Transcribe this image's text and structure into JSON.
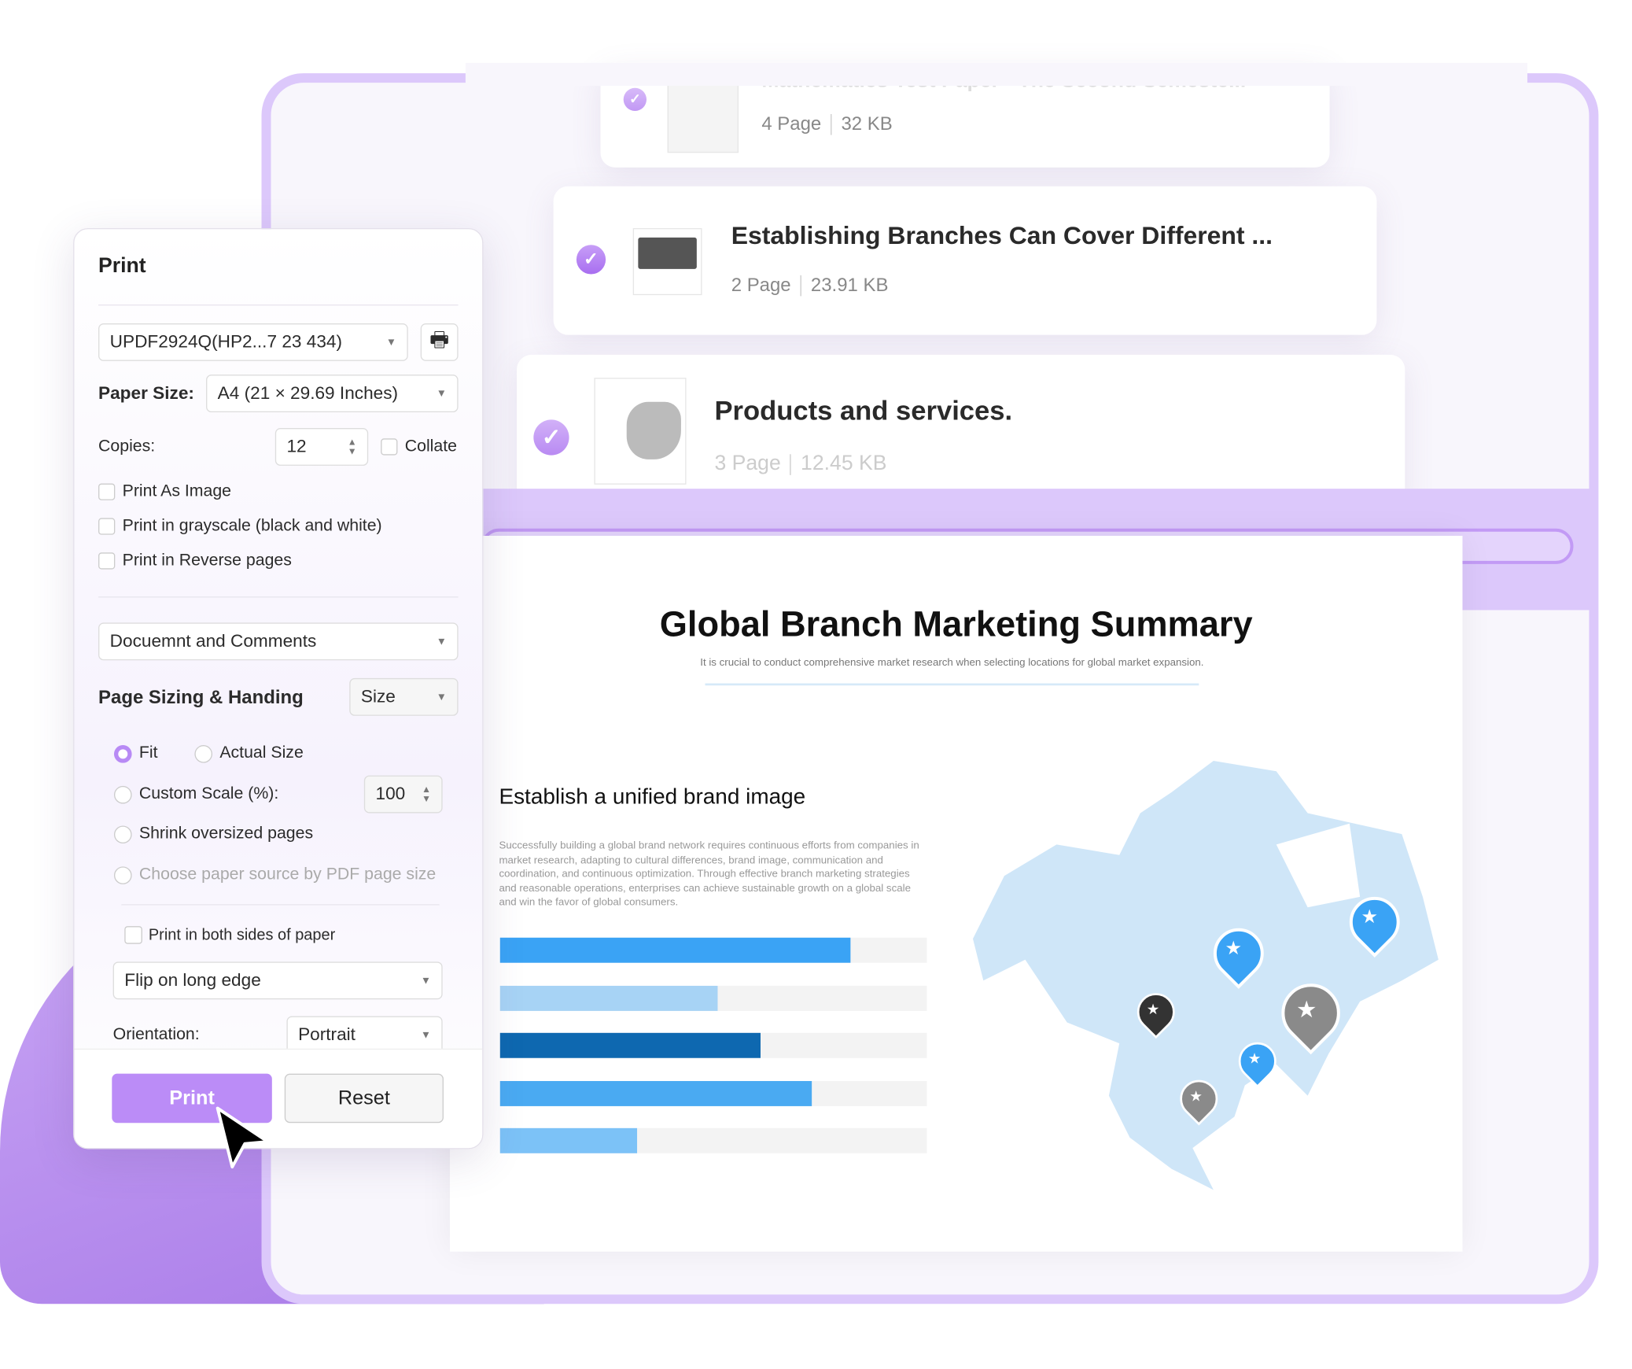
{
  "files": [
    {
      "title": "Mathematics Test Paper - The Second Semeste...",
      "pages": "4 Page",
      "size": "32 KB",
      "checked": true
    },
    {
      "title": "Establishing Branches Can Cover Different ...",
      "pages": "2 Page",
      "size": "23.91 KB",
      "checked": true
    },
    {
      "title": "Products and services.",
      "pages": "3 Page",
      "size": "12.45 KB",
      "checked": true
    }
  ],
  "document": {
    "title": "Global Branch Marketing Summary",
    "subtitle": "It is crucial to conduct comprehensive market research when selecting locations for global market expansion.",
    "section_title": "Establish a unified brand image",
    "body": "Successfully building a global brand network requires continuous efforts from companies in market research, adapting to cultural differences, brand image, communication and coordination, and continuous optimization. Through effective branch marketing strategies and reasonable operations, enterprises can achieve sustainable growth on a global scale and win the favor of global consumers.",
    "bars": [
      {
        "value": 0.82,
        "color": "#3aa3f5"
      },
      {
        "value": 0.51,
        "color": "#a7d3f5"
      },
      {
        "value": 0.61,
        "color": "#0e68b0"
      },
      {
        "value": 0.73,
        "color": "#4aaaf2"
      },
      {
        "value": 0.32,
        "color": "#7cc2f7"
      }
    ],
    "map_color": "#cfe6f8"
  },
  "dialog": {
    "title": "Print",
    "printer": "UPDF2924Q(HP2...7 23 434)",
    "printer_icon": "printer-icon",
    "paper_size_label": "Paper Size:",
    "paper_size": "A4 (21 × 29.69 Inches)",
    "copies_label": "Copies:",
    "copies": "12",
    "collate_label": "Collate",
    "collate": false,
    "print_as_image": "Print As Image",
    "grayscale": "Print in grayscale (black and white)",
    "reverse": "Print in Reverse pages",
    "content": "Docuemnt and Comments",
    "sizing_title": "Page Sizing & Handing",
    "sizing_mode": "Size",
    "fit": "Fit",
    "actual_size": "Actual Size",
    "custom_scale": "Custom Scale (%):",
    "scale_value": "100",
    "shrink": "Shrink oversized pages",
    "paper_source": "Choose paper source by PDF page size",
    "both_sides": "Print in both sides of paper",
    "flip": "Flip on long edge",
    "orientation_label": "Orientation:",
    "orientation": "Portrait",
    "print_button": "Print",
    "reset_button": "Reset",
    "accent": "#bb8cf7"
  }
}
